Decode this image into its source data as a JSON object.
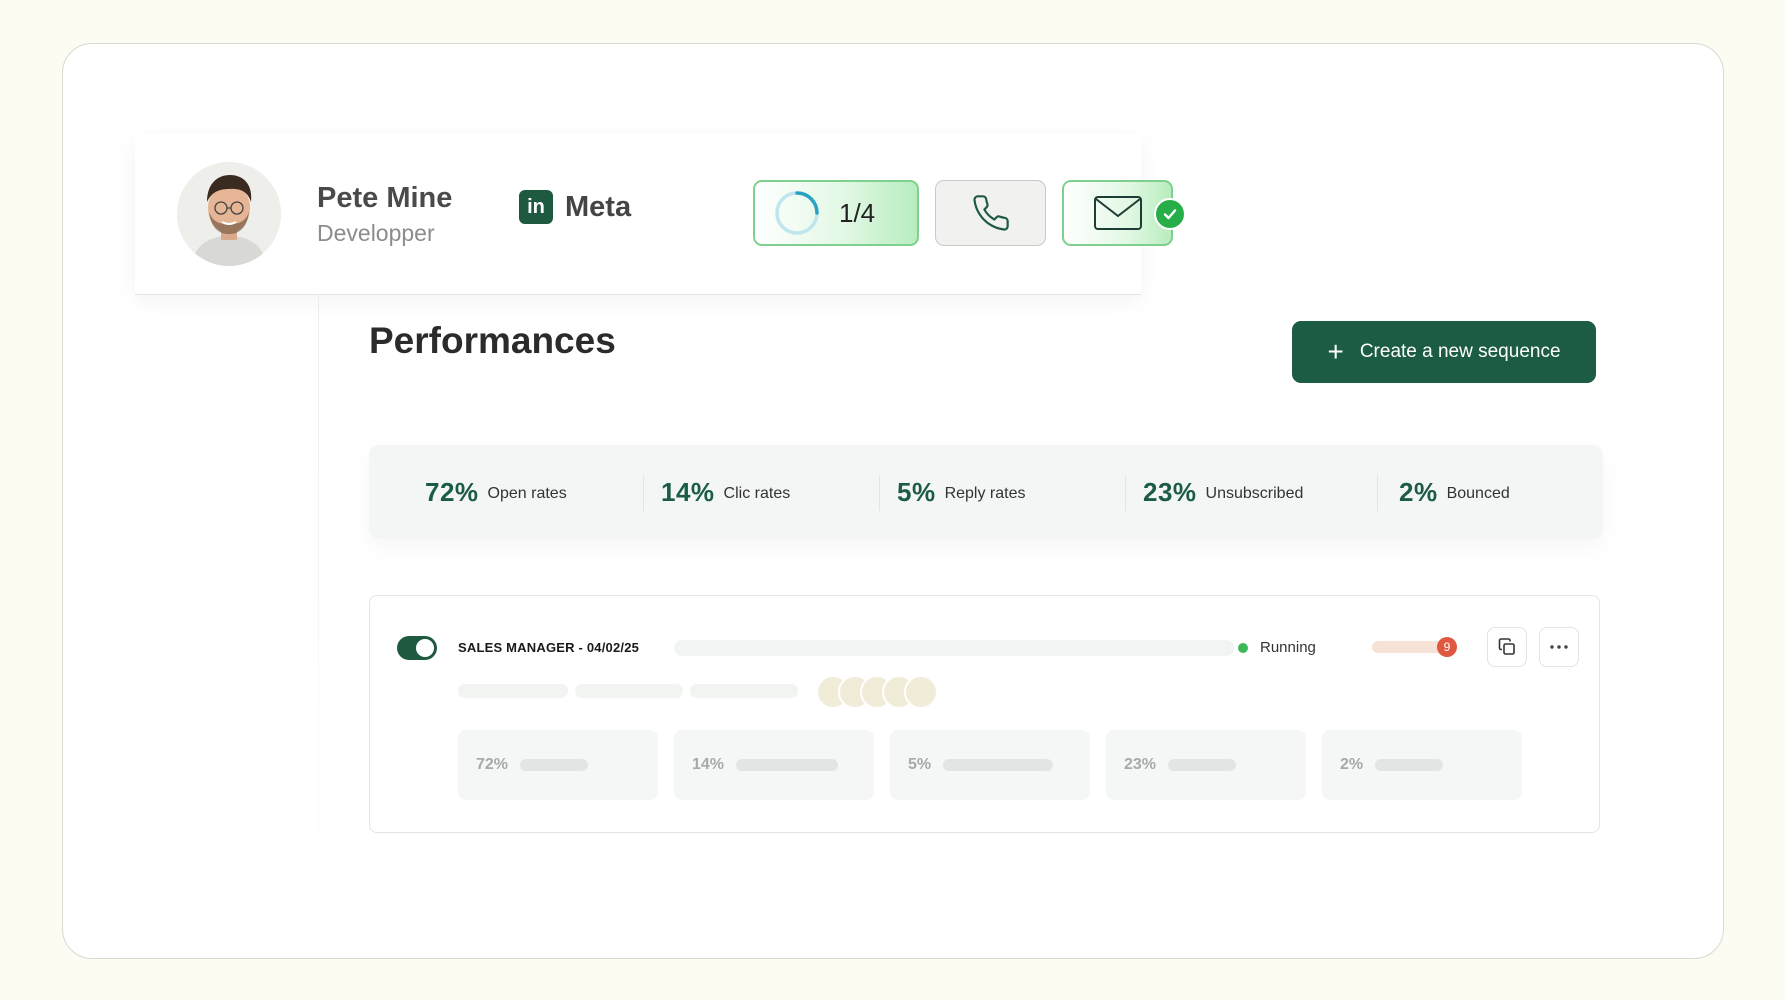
{
  "contact": {
    "name": "Pete Mine",
    "role": "Developper",
    "company": "Meta",
    "company_icon": "linkedin-icon",
    "step_progress": "1/4",
    "step_progress_fraction": 0.25,
    "email_status": "done"
  },
  "performances": {
    "title": "Performances",
    "create_button_label": "Create a new sequence",
    "stats": [
      {
        "value": "72%",
        "label": "Open rates"
      },
      {
        "value": "14%",
        "label": "Clic rates"
      },
      {
        "value": "5%",
        "label": "Reply rates"
      },
      {
        "value": "23%",
        "label": "Unsubscribed"
      },
      {
        "value": "2%",
        "label": "Bounced"
      }
    ]
  },
  "sequence": {
    "title": "SALES MANAGER - 04/02/25",
    "enabled": true,
    "status": "Running",
    "notification_count": "9",
    "metrics": [
      "72%",
      "14%",
      "5%",
      "23%",
      "2%"
    ]
  },
  "colors": {
    "brand": "#1b5c43",
    "success": "#27ae49",
    "running": "#3bb85a",
    "badge": "#df5840",
    "background": "#fdfcf2"
  }
}
